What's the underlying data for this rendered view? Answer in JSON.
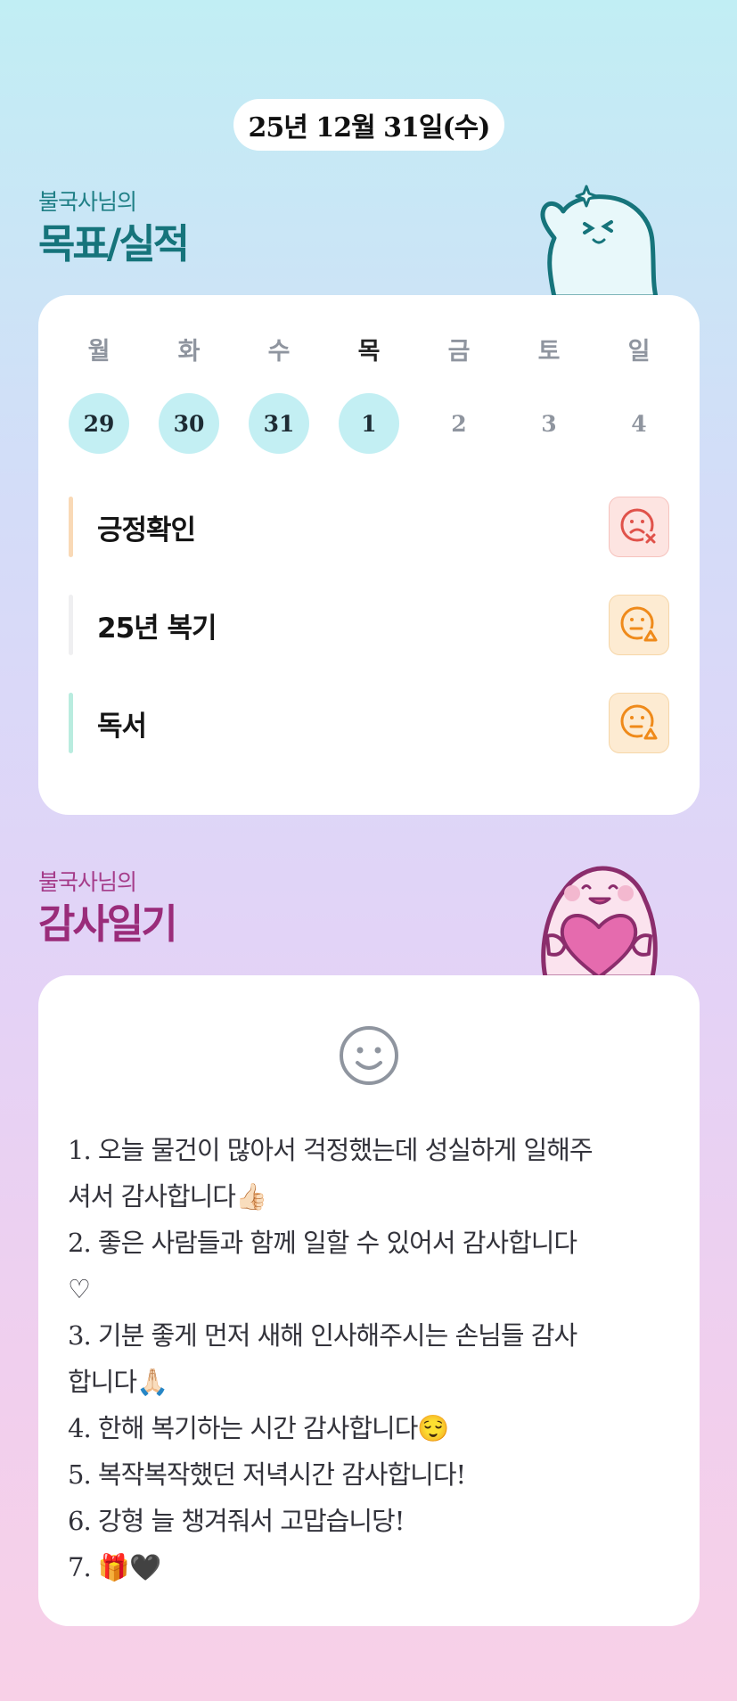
{
  "header": {
    "date": "25년 12월 31일(수)"
  },
  "goals": {
    "subtitle": "불국사님의",
    "title": "목표/실적",
    "week": [
      {
        "day": "월",
        "date": "29",
        "done": true,
        "today": false
      },
      {
        "day": "화",
        "date": "30",
        "done": true,
        "today": false
      },
      {
        "day": "수",
        "date": "31",
        "done": true,
        "today": false
      },
      {
        "day": "목",
        "date": "1",
        "done": true,
        "today": true
      },
      {
        "day": "금",
        "date": "2",
        "done": false,
        "today": false
      },
      {
        "day": "토",
        "date": "3",
        "done": false,
        "today": false
      },
      {
        "day": "일",
        "date": "4",
        "done": false,
        "today": false
      }
    ],
    "habits": [
      {
        "label": "긍정확인",
        "bar_color": "#f9d9b6",
        "status_icon": "sad-face-x-icon",
        "status_color": "#e0524a"
      },
      {
        "label": "25년 복기",
        "bar_color": "#efeff1",
        "status_icon": "neutral-face-triangle-icon",
        "status_color": "#ef8a1a"
      },
      {
        "label": "독서",
        "bar_color": "#b9ecdf",
        "status_icon": "neutral-face-triangle-icon",
        "status_color": "#ef8a1a"
      }
    ]
  },
  "thanks": {
    "subtitle": "불국사님의",
    "title": "감사일기",
    "mood_icon": "smiley-face-icon",
    "entries": [
      "1. 오늘 물건이 많아서 걱정했는데 성실하게 일해주\n셔서 감사합니다👍🏻",
      "2. 좋은 사람들과 함께 일할 수 있어서 감사합니다\n♡",
      "3. 기분 좋게 먼저 새해 인사해주시는 손님들 감사\n합니다🙏🏻",
      "4. 한해 복기하는 시간 감사합니다😌",
      "5. 복작복작했던 저녁시간 감사합니다!",
      "6. 강형 늘 챙겨줘서 고맙습니당!",
      "7. 🎁🖤"
    ]
  }
}
